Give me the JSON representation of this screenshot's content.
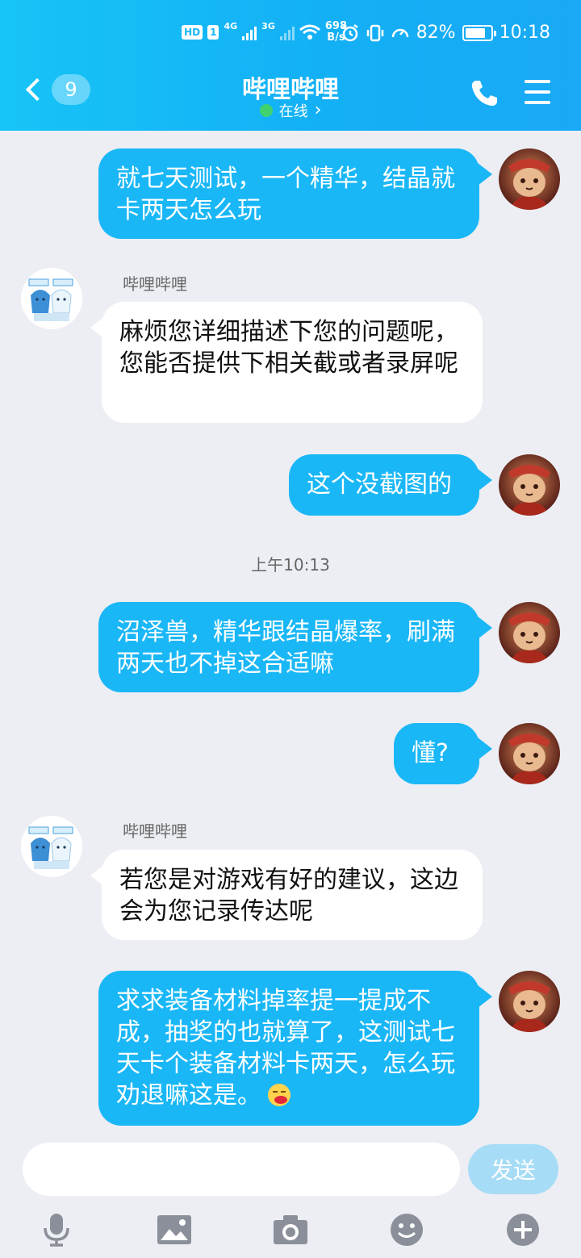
{
  "status_bar": {
    "hd": "HD",
    "sim": "1",
    "net1": "4G",
    "net2": "3G",
    "speed_value": "698",
    "speed_unit": "B/s",
    "battery": "82%",
    "battery_level": 0.82,
    "time": "10:18"
  },
  "header": {
    "unread_count": "9",
    "title": "哔哩哔哩",
    "status": "在线",
    "status_chevron": "›"
  },
  "messages": [
    {
      "side": "out",
      "text": "就七天测试，一个精华，结晶就卡两天怎么玩"
    },
    {
      "side": "in",
      "sender": "哔哩哔哩",
      "text": "麻烦您详细描述下您的问题呢，您能否提供下相关截或者录屏呢"
    },
    {
      "side": "out",
      "text": "这个没截图的"
    },
    {
      "side": "time",
      "text": "上午10:13"
    },
    {
      "side": "out",
      "text": "沼泽兽，精华跟结晶爆率，刷满两天也不掉这合适嘛"
    },
    {
      "side": "out",
      "text": "懂?"
    },
    {
      "side": "in",
      "sender": "哔哩哔哩",
      "text": "若您是对游戏有好的建议，这边会为您记录传达呢"
    },
    {
      "side": "out",
      "text": "求求装备材料掉率提一提成不成，抽奖的也就算了，这测试七天卡个装备材料卡两天，怎么玩 劝退嘛这是。",
      "emoji": "emoji-vomit-icon"
    }
  ],
  "input": {
    "placeholder": "",
    "send_label": "发送"
  },
  "toolbar": [
    "microphone-icon",
    "image-icon",
    "camera-icon",
    "emoji-icon",
    "plus-icon"
  ],
  "colors": {
    "header_bg": "#17b9f6",
    "bubble_out": "#1ab7f7",
    "bubble_in": "#ffffff",
    "background": "#eceef3",
    "send_disabled": "#a6dcf6",
    "online": "#3fd26f"
  }
}
